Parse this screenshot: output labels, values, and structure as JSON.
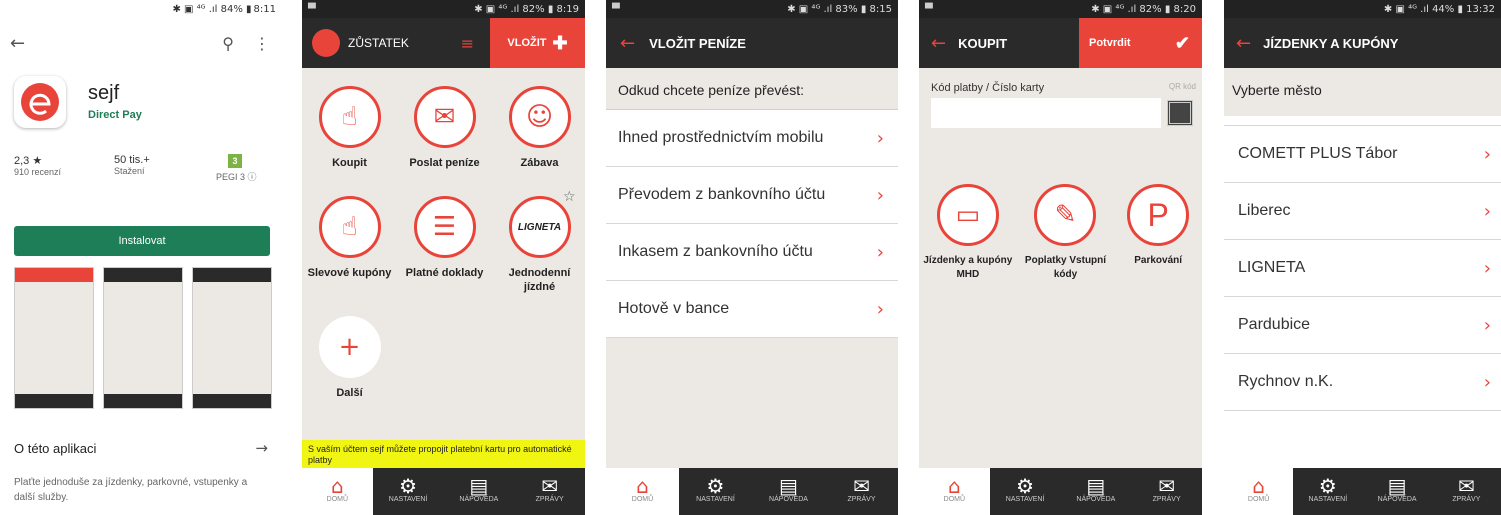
{
  "colors": {
    "accent": "#e8443a",
    "store_green": "#1e7e57",
    "app_bg": "#ece8e3",
    "dark": "#2a2a2a",
    "yellow": "#f0f511"
  },
  "store": {
    "status_time": "8:11",
    "status_battery": "84%",
    "app_name": "sejf",
    "developer": "Direct Pay",
    "rating": "2,3 ★",
    "reviews": "910 recenzí",
    "downloads": "50 tis.+",
    "downloads_label": "Stažení",
    "pegi_badge": "3",
    "pegi_label": "PEGI 3 ⓘ",
    "install_label": "Instalovat",
    "about_title": "O této aplikaci",
    "about_text": "Plaťte jednoduše za jízdenky, parkovné, vstupenky a další služby."
  },
  "home": {
    "status_time": "8:19",
    "status_battery": "82%",
    "balance_label": "ZŮSTATEK",
    "deposit_label": "VLOŽIT",
    "tiles": [
      {
        "label": "Koupit",
        "icon": "bag-icon"
      },
      {
        "label": "Poslat peníze",
        "icon": "money-icon"
      },
      {
        "label": "Zábava",
        "icon": "masks-icon"
      },
      {
        "label": "Slevové kupóny",
        "icon": "thumbs-up-icon"
      },
      {
        "label": "Platné doklady",
        "icon": "receipt-icon"
      },
      {
        "label": "Jednodenní jízdné",
        "icon": "ligneta-logo"
      },
      {
        "label": "Další",
        "icon": "plus-icon"
      }
    ],
    "ligneta": "LIGNETA",
    "banner": "S vaším účtem sejf můžete propojit platební kartu pro automatické platby"
  },
  "deposit": {
    "status_time": "8:15",
    "status_battery": "83%",
    "title": "VLOŽIT PENÍZE",
    "question": "Odkud chcete peníze převést:",
    "options": [
      "Ihned prostřednictvím mobilu",
      "Převodem z bankovního účtu",
      "Inkasem z bankovního účtu",
      "Hotově v bance"
    ]
  },
  "buy": {
    "status_time": "8:20",
    "status_battery": "82%",
    "title": "KOUPIT",
    "confirm": "Potvrdit",
    "field_label": "Kód platby / Číslo karty",
    "qr_label": "QR kód",
    "items": [
      "Jízdenky a kupóny MHD",
      "Poplatky Vstupní kódy",
      "Parkování"
    ]
  },
  "tickets": {
    "status_time": "13:32",
    "status_battery": "44%",
    "title": "JÍZDENKY A KUPÓNY",
    "select_city": "Vyberte město",
    "cities": [
      "COMETT PLUS Tábor",
      "Liberec",
      "LIGNETA",
      "Pardubice",
      "Rychnov n.K."
    ]
  },
  "tabbar": [
    "DOMŮ",
    "NASTAVENÍ",
    "NÁPOVĚDA",
    "ZPRÁVY"
  ]
}
